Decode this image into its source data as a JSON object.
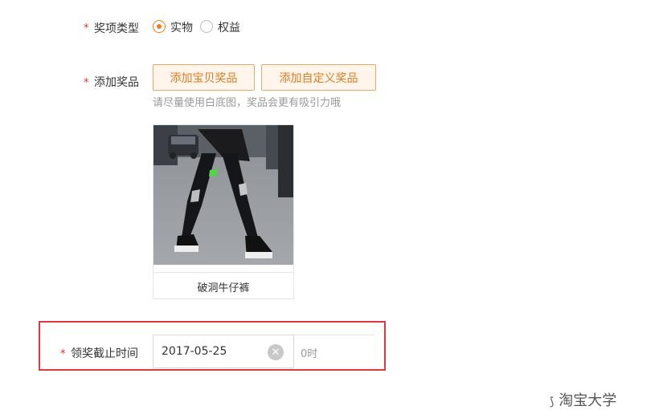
{
  "prize_type": {
    "label": "奖项类型",
    "options": [
      {
        "label": "实物",
        "checked": true
      },
      {
        "label": "权益",
        "checked": false
      }
    ]
  },
  "add_prize": {
    "label": "添加奖品",
    "buttons": [
      "添加宝贝奖品",
      "添加自定义奖品"
    ],
    "hint": "请尽量使用白底图，奖品会更有吸引力哦"
  },
  "prize_card": {
    "caption": "破洞牛仔裤"
  },
  "deadline": {
    "label": "领奖截止时间",
    "date_value": "2017-05-25",
    "hour_suffix": "0时"
  },
  "watermark": "淘宝大学",
  "colors": {
    "accent": "#f37b1d",
    "required": "#e0312a",
    "highlight_box": "#e0383e"
  }
}
